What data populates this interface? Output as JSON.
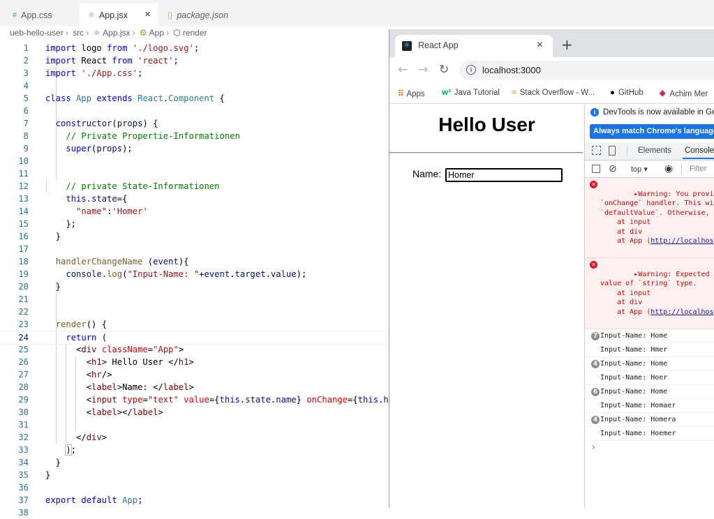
{
  "editor": {
    "tabs": [
      {
        "icon": "#",
        "label": "App.css",
        "italic": false
      },
      {
        "icon": "⚛",
        "label": "App.jsx",
        "italic": false,
        "close": "×"
      },
      {
        "icon": "{}",
        "label": "package.json",
        "italic": true
      }
    ],
    "breadcrumb": [
      "ueb-hello-user",
      "src",
      "App.jsx",
      "App",
      "render"
    ],
    "line_numbers": [
      "1",
      "2",
      "3",
      "4",
      "5",
      "6",
      "7",
      "8",
      "9",
      "10",
      "11",
      "12",
      "13",
      "14",
      "15",
      "16",
      "17",
      "18",
      "19",
      "20",
      "21",
      "22",
      "23",
      "24",
      "25",
      "26",
      "27",
      "28",
      "29",
      "30",
      "31",
      "32",
      "33",
      "34",
      "35",
      "36",
      "37",
      "38"
    ],
    "current_line": "24"
  },
  "browser": {
    "tab_title": "React App",
    "tab_close": "×",
    "new_tab": "+",
    "url": "localhost:3000",
    "bookmarks": [
      "Apps",
      "Java Tutorial",
      "Stack Overflow - W...",
      "GitHub",
      "Achim Mer"
    ]
  },
  "page": {
    "heading": "Hello User",
    "name_label": "Name:",
    "name_value": "Homer"
  },
  "devtools": {
    "info": "DevTools is now available in Ger",
    "language_button": "Always match Chrome's language",
    "tabs": [
      "Elements",
      "Console"
    ],
    "context": "top",
    "filter_placeholder": "Filter",
    "warnings": [
      {
        "lines": [
          "▸Warning: You provided a `",
          "`onChange` handler. This wi",
          "`defaultValue`. Otherwise,",
          "    at input",
          "    at div",
          "    at App ("
        ],
        "link": "http://localhos"
      },
      {
        "lines": [
          "▸Warning: Expected `onChan",
          "value of `string` type.",
          "    at input",
          "    at div",
          "    at App ("
        ],
        "link": "http://localhos"
      }
    ],
    "logs": [
      {
        "count": "7",
        "text": "Input-Name: Home"
      },
      {
        "count": "",
        "text": "Input-Name: Hmer"
      },
      {
        "count": "4",
        "text": "Input-Name: Home"
      },
      {
        "count": "",
        "text": "Input-Name: Hoer"
      },
      {
        "count": "6",
        "text": "Input-Name: Home"
      },
      {
        "count": "",
        "text": "Input-Name: Homaer"
      },
      {
        "count": "4",
        "text": "Input-Name: Homera"
      },
      {
        "count": "",
        "text": "Input-Name: Hoemer"
      }
    ],
    "prompt": "›"
  },
  "colors": {
    "keyword": "#0000ff",
    "string": "#a31515",
    "comment": "#008000",
    "chrome_blue": "#1a73e8",
    "error_red": "#e81123"
  }
}
